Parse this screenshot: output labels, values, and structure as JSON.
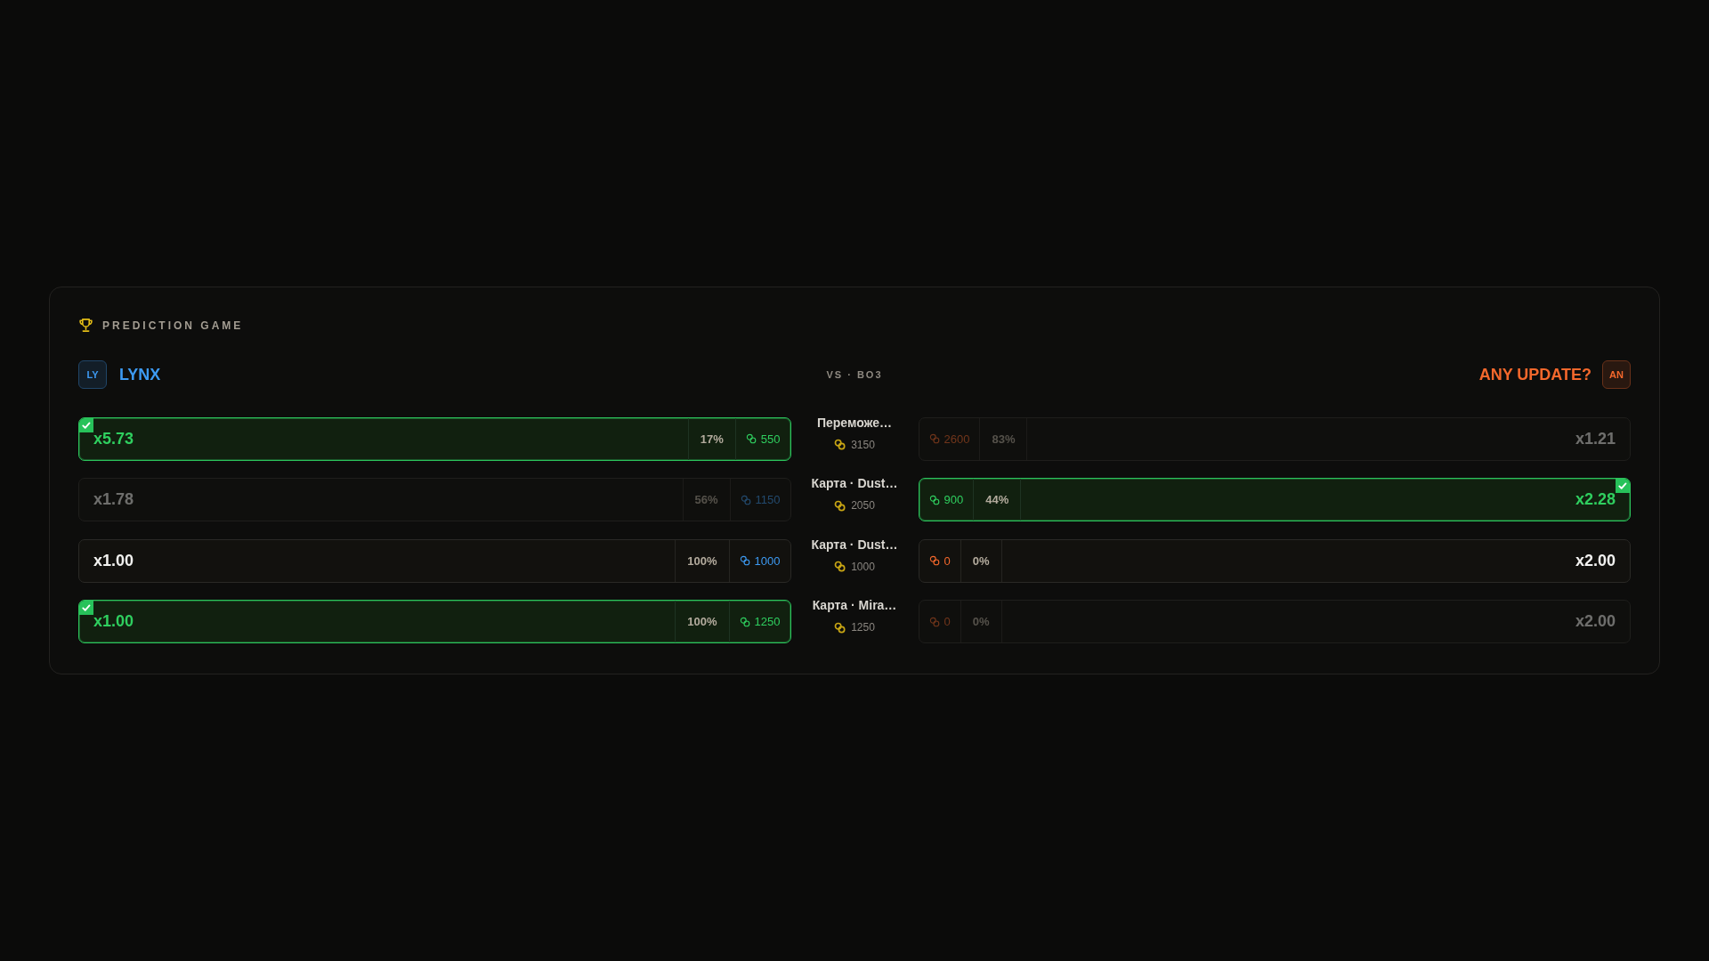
{
  "header": {
    "title": "PREDICTION GAME"
  },
  "teams": [
    {
      "tag": "LY",
      "name": "LYNX",
      "color": "#3d9af2"
    },
    {
      "tag": "AN",
      "name": "ANY UPDATE?",
      "color": "#f4682c"
    }
  ],
  "match": {
    "label": "VS · BO3"
  },
  "markets": [
    {
      "name": "Переможе…",
      "pool": "3150",
      "left": {
        "odds": "x5.73",
        "share": "17%",
        "stake": "550",
        "selected": true,
        "faded": false
      },
      "right": {
        "odds": "x1.21",
        "share": "83%",
        "stake": "2600",
        "selected": false,
        "faded": true
      }
    },
    {
      "name": "Карта · Dust…",
      "pool": "2050",
      "left": {
        "odds": "x1.78",
        "share": "56%",
        "stake": "1150",
        "selected": false,
        "faded": true
      },
      "right": {
        "odds": "x2.28",
        "share": "44%",
        "stake": "900",
        "selected": true,
        "faded": false
      }
    },
    {
      "name": "Карта · Dust…",
      "pool": "1000",
      "left": {
        "odds": "x1.00",
        "share": "100%",
        "stake": "1000",
        "selected": false,
        "faded": false
      },
      "right": {
        "odds": "x2.00",
        "share": "0%",
        "stake": "0",
        "selected": false,
        "faded": false
      }
    },
    {
      "name": "Карта · Mira…",
      "pool": "1250",
      "left": {
        "odds": "x1.00",
        "share": "100%",
        "stake": "1250",
        "selected": true,
        "faded": false
      },
      "right": {
        "odds": "x2.00",
        "share": "0%",
        "stake": "0",
        "selected": false,
        "faded": true
      }
    }
  ]
}
